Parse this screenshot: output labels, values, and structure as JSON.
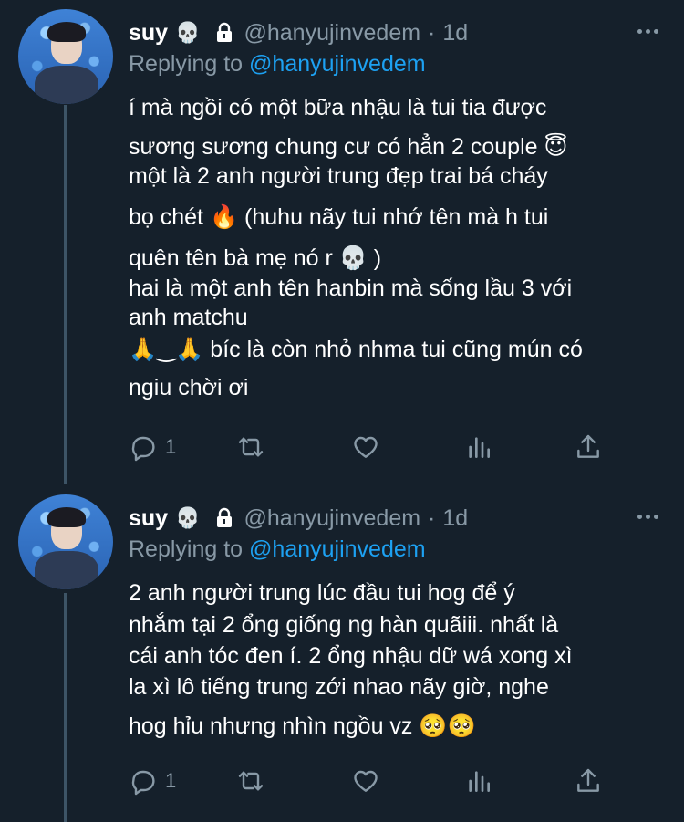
{
  "tweets": [
    {
      "author": {
        "display_name": "suy",
        "name_emoji": "💀",
        "handle": "@hanyujinvedem",
        "separator": "·",
        "time": "1d"
      },
      "replying_label": "Replying to",
      "replying_to": "@hanyujinvedem",
      "lines": [
        "í mà ngồi có một bữa nhậu là tui tia được",
        "sương sương chung cư có hẳn 2 couple 😇",
        "một là 2 anh người trung đẹp trai bá cháy",
        "bọ chét 🔥  (huhu nãy tui nhớ tên mà h tui",
        "quên tên bà mẹ nó r 💀 )",
        "hai là một anh tên hanbin mà sống lầu 3 với",
        "anh matchu",
        "🙏‿🙏 bíc là còn nhỏ nhma tui cũng mún có",
        "ngiu chời ơi"
      ],
      "reply_count": "1"
    },
    {
      "author": {
        "display_name": "suy",
        "name_emoji": "💀",
        "handle": "@hanyujinvedem",
        "separator": "·",
        "time": "1d"
      },
      "replying_label": "Replying to",
      "replying_to": "@hanyujinvedem",
      "lines": [
        "2 anh người trung lúc đầu tui hog để ý",
        "nhắm tại 2 ổng giống ng hàn quãiii. nhất là",
        "cái anh tóc đen í. 2 ổng nhậu dữ wá xong xì",
        "la xì lô tiếng trung zới nhao nãy giờ, nghe",
        "hog hỉu nhưng nhìn ngồu vz 🥺🥺"
      ],
      "reply_count": "1"
    }
  ],
  "icons": {
    "reply": "reply-icon",
    "retweet": "retweet-icon",
    "like": "heart-icon",
    "stats": "analytics-icon",
    "share": "share-icon",
    "more": "more-icon",
    "lock": "lock-icon"
  },
  "colors": {
    "background": "#15202b",
    "muted": "#8899a6",
    "link": "#1da1f2",
    "thread": "#3d5466"
  }
}
